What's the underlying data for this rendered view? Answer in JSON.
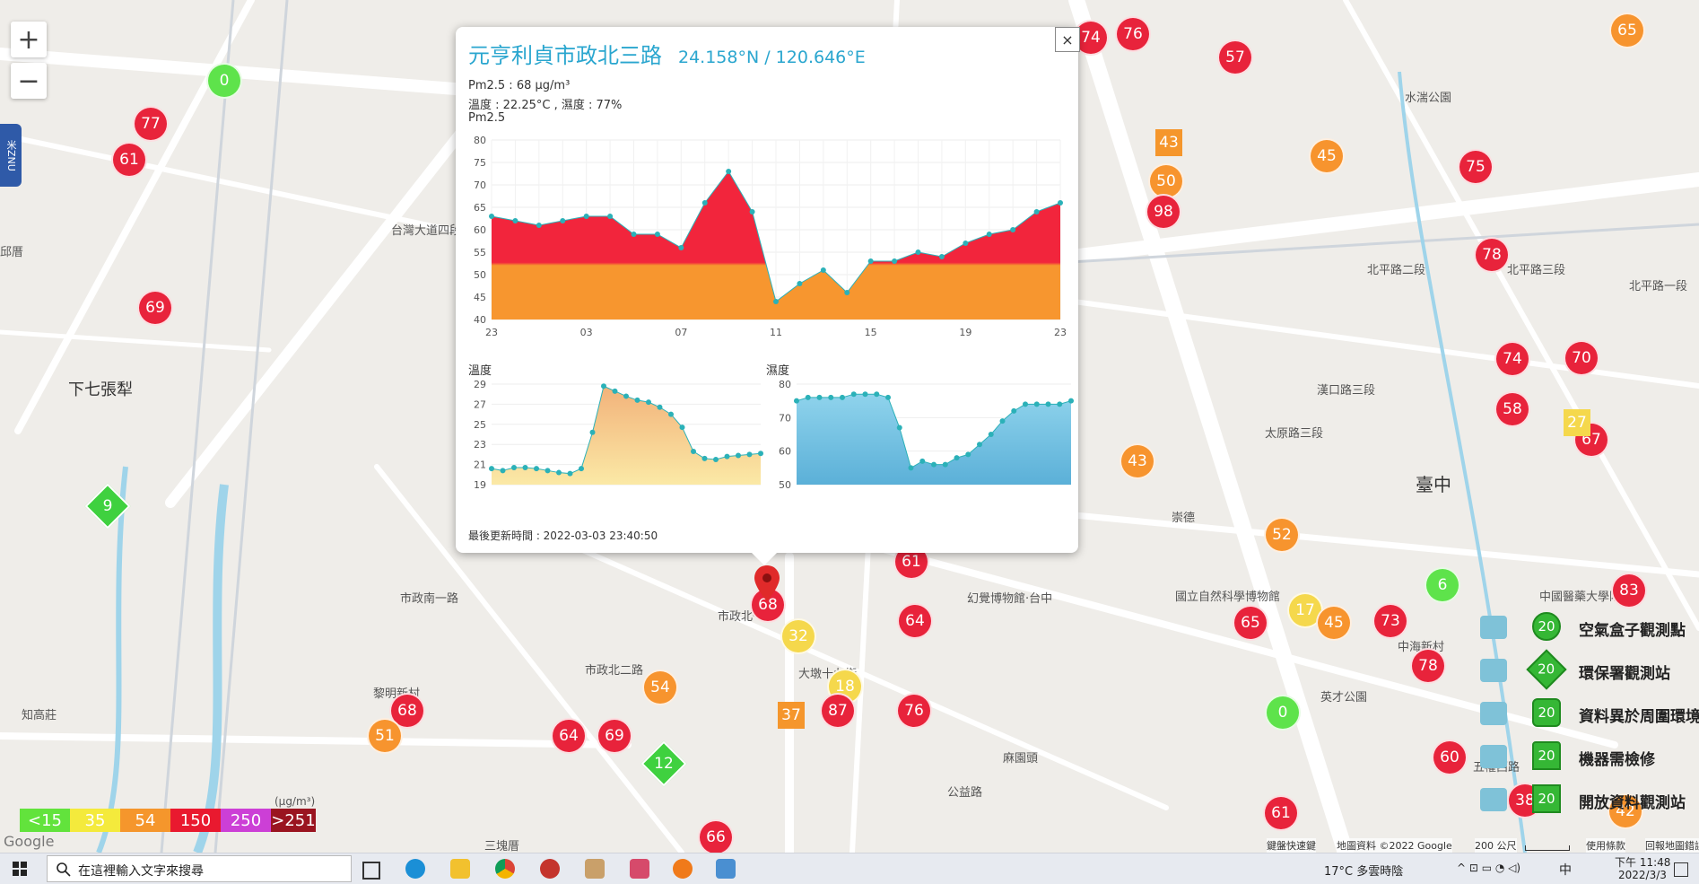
{
  "popup": {
    "title": "元亨利貞市政北三路",
    "coord": "24.158°N / 120.646°E",
    "pm25_line": "Pm2.5 : 68 μg/m³",
    "temp_line": "溫度 : 22.25°C , 濕度 : 77%",
    "chart_label": "Pm2.5",
    "temp_label": "溫度",
    "hum_label": "濕度",
    "updated": "最後更新時間 : 2022-03-03 23:40:50",
    "close": "×"
  },
  "chart_data": [
    {
      "type": "area",
      "name": "Pm2.5",
      "x": [
        "23",
        "",
        "",
        "",
        "03",
        "",
        "",
        "",
        "07",
        "",
        "",
        "",
        "11",
        "",
        "",
        "",
        "15",
        "",
        "",
        "",
        "19",
        "",
        "",
        "",
        "23"
      ],
      "values": [
        63,
        62,
        61,
        62,
        63,
        63,
        59,
        59,
        56,
        66,
        73,
        64,
        44,
        48,
        51,
        46,
        53,
        53,
        55,
        54,
        57,
        59,
        60,
        64,
        66
      ],
      "ylim": [
        40,
        80
      ],
      "yticks": [
        40,
        45,
        50,
        55,
        60,
        65,
        70,
        75,
        80
      ],
      "xticks": [
        "23",
        "03",
        "07",
        "11",
        "15",
        "19",
        "23"
      ],
      "threshold": 55,
      "colors": {
        "above": "#f2253c",
        "below": "#f7962f"
      }
    },
    {
      "type": "area",
      "name": "溫度",
      "values": [
        20.6,
        20.4,
        20.7,
        20.7,
        20.6,
        20.4,
        20.2,
        20.1,
        20.6,
        24.2,
        28.8,
        28.3,
        27.8,
        27.4,
        27.2,
        26.7,
        26.0,
        24.7,
        22.3,
        21.6,
        21.5,
        21.8,
        21.9,
        22.0,
        22.1
      ],
      "ylim": [
        19,
        29
      ],
      "yticks": [
        19,
        21,
        23,
        25,
        27,
        29
      ],
      "colors": {
        "top": "#f2b27a",
        "bottom": "#fbe9a6",
        "line": "#2bb1b8"
      }
    },
    {
      "type": "area",
      "name": "濕度",
      "values": [
        75,
        76,
        76,
        76,
        76,
        77,
        77,
        77,
        76,
        67,
        55,
        57,
        56,
        56,
        58,
        59,
        62,
        65,
        69,
        72,
        74,
        74,
        74,
        74,
        75
      ],
      "ylim": [
        50,
        80
      ],
      "yticks": [
        50,
        60,
        70,
        80
      ],
      "colors": {
        "top": "#8fd3ec",
        "bottom": "#5bb0d8",
        "line": "#2bb1b8"
      }
    }
  ],
  "map": {
    "labels": [
      "下七張犁",
      "臺中",
      "黎明新村",
      "知高莊",
      "三塊厝",
      "麻園頭",
      "中海新村",
      "水湍公園",
      "台灣大道四段",
      "邱厝",
      "北平路三段",
      "漢口路三段",
      "太原路三段",
      "市政北一路",
      "市政南一路",
      "市政北二路",
      "大墩十九街",
      "幻覺博物館·台中",
      "國立自然科學博物館",
      "中國醫藥大學附設",
      "北平路一段",
      "北平路二段",
      "英才公園",
      "五權西路",
      "公益路",
      "崇德",
      "邱厝"
    ],
    "markers": [
      {
        "v": "0",
        "c": "green"
      },
      {
        "v": "77",
        "c": "red"
      },
      {
        "v": "61",
        "c": "red"
      },
      {
        "v": "69",
        "c": "red"
      },
      {
        "v": "57",
        "c": "red"
      },
      {
        "v": "74",
        "c": "red"
      },
      {
        "v": "76",
        "c": "red"
      },
      {
        "v": "75",
        "c": "red"
      },
      {
        "v": "43",
        "c": "orange"
      },
      {
        "v": "45",
        "c": "orange"
      },
      {
        "v": "50",
        "c": "orange"
      },
      {
        "v": "98",
        "c": "red"
      },
      {
        "v": "78",
        "c": "red"
      },
      {
        "v": "74",
        "c": "red"
      },
      {
        "v": "70",
        "c": "red"
      },
      {
        "v": "58",
        "c": "red"
      },
      {
        "v": "67",
        "c": "red"
      },
      {
        "v": "43",
        "c": "orange"
      },
      {
        "v": "52",
        "c": "orange"
      },
      {
        "v": "61",
        "c": "red"
      },
      {
        "v": "68",
        "c": "red"
      },
      {
        "v": "32",
        "c": "yellow"
      },
      {
        "v": "64",
        "c": "red"
      },
      {
        "v": "18",
        "c": "yellow"
      },
      {
        "v": "87",
        "c": "red"
      },
      {
        "v": "76",
        "c": "red"
      },
      {
        "v": "54",
        "c": "orange"
      },
      {
        "v": "64",
        "c": "red"
      },
      {
        "v": "69",
        "c": "red"
      },
      {
        "v": "68",
        "c": "red"
      },
      {
        "v": "51",
        "c": "orange"
      },
      {
        "v": "66",
        "c": "red"
      },
      {
        "v": "6",
        "c": "green"
      },
      {
        "v": "17",
        "c": "yellow"
      },
      {
        "v": "45",
        "c": "orange"
      },
      {
        "v": "65",
        "c": "red"
      },
      {
        "v": "73",
        "c": "red"
      },
      {
        "v": "78",
        "c": "red"
      },
      {
        "v": "0",
        "c": "green"
      },
      {
        "v": "60",
        "c": "red"
      },
      {
        "v": "61",
        "c": "red"
      },
      {
        "v": "83",
        "c": "red"
      },
      {
        "v": "65",
        "c": "red"
      },
      {
        "v": "38",
        "c": "orange"
      },
      {
        "v": "42",
        "c": "orange"
      }
    ],
    "square_markers": [
      {
        "v": "43"
      },
      {
        "v": "37"
      },
      {
        "v": "27"
      }
    ],
    "diamond_markers": [
      {
        "v": "9"
      },
      {
        "v": "12"
      }
    ],
    "zoom_in": "+",
    "zoom_out": "−",
    "side_tab": "米ZNU"
  },
  "legend": {
    "rows": [
      {
        "num": "20",
        "text": "空氣盒子觀測點"
      },
      {
        "num": "20",
        "text": "環保署觀測站"
      },
      {
        "num": "20",
        "text": "資料異於周圍環境"
      },
      {
        "num": "20",
        "text": "機器需檢修"
      },
      {
        "num": "20",
        "text": "開放資料觀測站"
      }
    ],
    "aqi": [
      {
        "label": "<15",
        "color": "#62e33c"
      },
      {
        "label": "35",
        "color": "#f4ea3c"
      },
      {
        "label": "54",
        "color": "#f5962c"
      },
      {
        "label": "150",
        "color": "#e9192f"
      },
      {
        "label": "250",
        "color": "#cc3fd6"
      },
      {
        "label": ">251",
        "color": "#9a1420"
      }
    ],
    "unit": "(μg/m³)"
  },
  "attribution": {
    "google": "Google",
    "shortcuts": "鍵盤快速鍵",
    "mapdata": "地圖資料 ©2022 Google",
    "scale": "200 公尺",
    "terms": "使用條款",
    "report": "回報地圖錯誤"
  },
  "taskbar": {
    "search_placeholder": "在這裡輸入文字來搜尋",
    "weather": "17°C  多雲時陰",
    "ime": "中",
    "time": "下午 11:48",
    "date": "2022/3/3"
  }
}
